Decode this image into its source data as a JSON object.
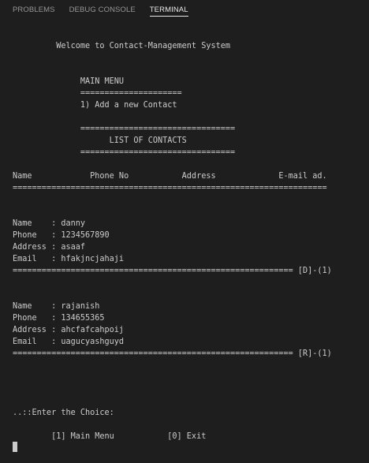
{
  "tabs": [
    "PROBLEMS",
    "DEBUG CONSOLE",
    "TERMINAL"
  ],
  "terminal": {
    "welcome": "         Welcome to Contact-Management System",
    "menu_title": "              MAIN MENU",
    "menu_rule": "              =====================",
    "menu_item_1": "              1) Add a new Contact",
    "list_rule_top": "              ================================",
    "list_title": "                    LIST OF CONTACTS",
    "list_rule_bottom": "              ================================",
    "table_header": "Name            Phone No           Address             E-mail ad.",
    "table_rule": "=================================================================",
    "contacts": [
      {
        "name": "Name    : danny",
        "phone": "Phone   : 1234567890",
        "address": "Address : asaaf",
        "email": "Email   : hfakjncjahaji",
        "rule": "========================================================== [D]-(1)"
      },
      {
        "name": "Name    : rajanish",
        "phone": "Phone   : 134655365",
        "address": "Address : ahcfafcahpoij",
        "email": "Email   : uagucyashguyd",
        "rule": "========================================================== [R]-(1)"
      }
    ],
    "prompt": "..::Enter the Choice:",
    "options": "        [1] Main Menu           [0] Exit"
  }
}
